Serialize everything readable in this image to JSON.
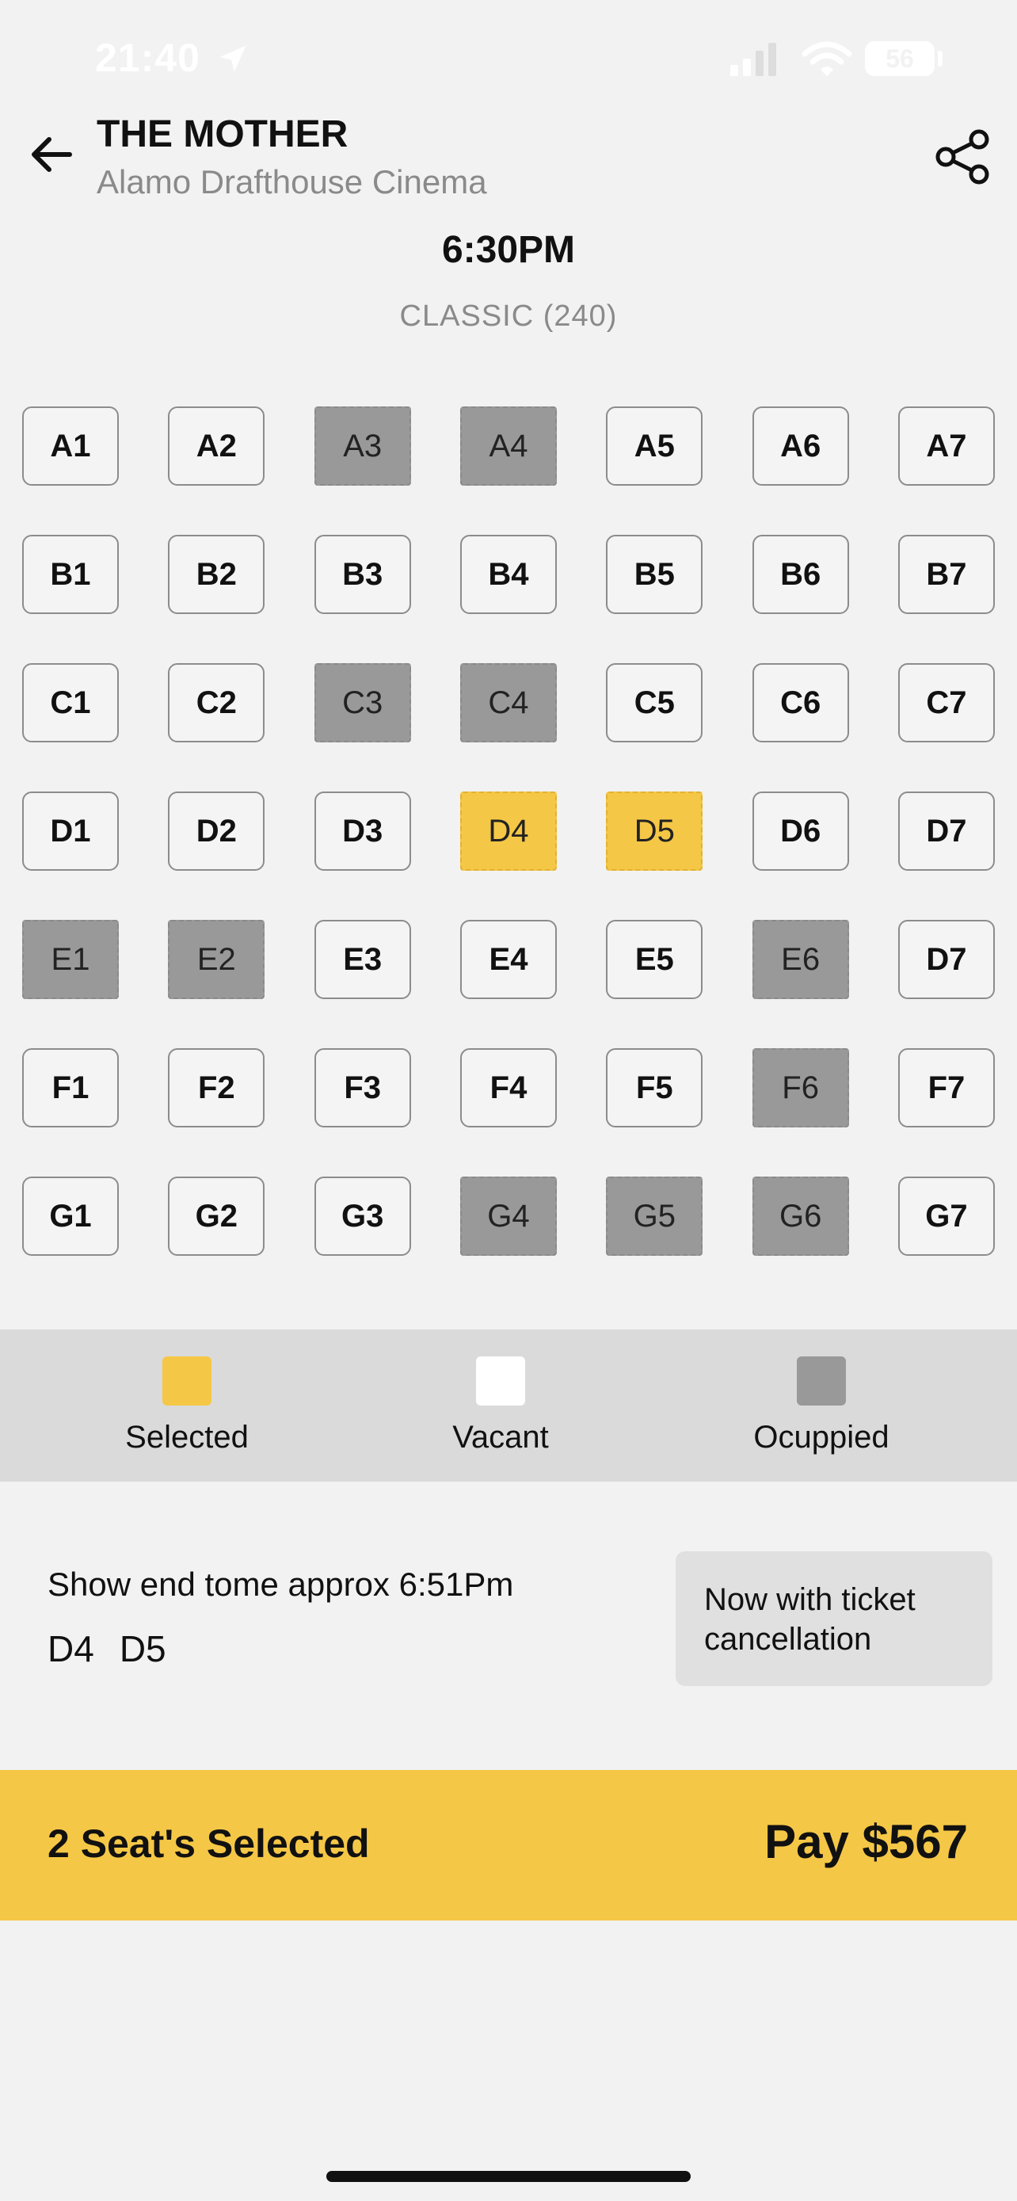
{
  "status_bar": {
    "time": "21:40",
    "battery": "56"
  },
  "header": {
    "movie_title": "THE MOTHER",
    "cinema_name": "Alamo Drafthouse Cinema",
    "showtime": "6:30PM",
    "screen_type": "CLASSIC (240)"
  },
  "seat_rows": [
    [
      {
        "label": "A1",
        "status": "vacant"
      },
      {
        "label": "A2",
        "status": "vacant"
      },
      {
        "label": "A3",
        "status": "occupied"
      },
      {
        "label": "A4",
        "status": "occupied"
      },
      {
        "label": "A5",
        "status": "vacant"
      },
      {
        "label": "A6",
        "status": "vacant"
      },
      {
        "label": "A7",
        "status": "vacant"
      }
    ],
    [
      {
        "label": "B1",
        "status": "vacant"
      },
      {
        "label": "B2",
        "status": "vacant"
      },
      {
        "label": "B3",
        "status": "vacant"
      },
      {
        "label": "B4",
        "status": "vacant"
      },
      {
        "label": "B5",
        "status": "vacant"
      },
      {
        "label": "B6",
        "status": "vacant"
      },
      {
        "label": "B7",
        "status": "vacant"
      }
    ],
    [
      {
        "label": "C1",
        "status": "vacant"
      },
      {
        "label": "C2",
        "status": "vacant"
      },
      {
        "label": "C3",
        "status": "occupied"
      },
      {
        "label": "C4",
        "status": "occupied"
      },
      {
        "label": "C5",
        "status": "vacant"
      },
      {
        "label": "C6",
        "status": "vacant"
      },
      {
        "label": "C7",
        "status": "vacant"
      }
    ],
    [
      {
        "label": "D1",
        "status": "vacant"
      },
      {
        "label": "D2",
        "status": "vacant"
      },
      {
        "label": "D3",
        "status": "vacant"
      },
      {
        "label": "D4",
        "status": "selected"
      },
      {
        "label": "D5",
        "status": "selected"
      },
      {
        "label": "D6",
        "status": "vacant"
      },
      {
        "label": "D7",
        "status": "vacant"
      }
    ],
    [
      {
        "label": "E1",
        "status": "occupied"
      },
      {
        "label": "E2",
        "status": "occupied"
      },
      {
        "label": "E3",
        "status": "vacant"
      },
      {
        "label": "E4",
        "status": "vacant"
      },
      {
        "label": "E5",
        "status": "vacant"
      },
      {
        "label": "E6",
        "status": "occupied"
      },
      {
        "label": "D7",
        "status": "vacant"
      }
    ],
    [
      {
        "label": "F1",
        "status": "vacant"
      },
      {
        "label": "F2",
        "status": "vacant"
      },
      {
        "label": "F3",
        "status": "vacant"
      },
      {
        "label": "F4",
        "status": "vacant"
      },
      {
        "label": "F5",
        "status": "vacant"
      },
      {
        "label": "F6",
        "status": "occupied"
      },
      {
        "label": "F7",
        "status": "vacant"
      }
    ],
    [
      {
        "label": "G1",
        "status": "vacant"
      },
      {
        "label": "G2",
        "status": "vacant"
      },
      {
        "label": "G3",
        "status": "vacant"
      },
      {
        "label": "G4",
        "status": "occupied"
      },
      {
        "label": "G5",
        "status": "occupied"
      },
      {
        "label": "G6",
        "status": "occupied"
      },
      {
        "label": "G7",
        "status": "vacant"
      }
    ]
  ],
  "legend": {
    "selected_label": "Selected",
    "vacant_label": "Vacant",
    "occupied_label": "Ocuppied"
  },
  "colors": {
    "selected": "#f5c746",
    "vacant": "#ffffff",
    "occupied": "#999999",
    "legend_bg": "#dadada"
  },
  "summary": {
    "end_time_text": "Show end tome approx 6:51Pm",
    "selected_seats": [
      "D4",
      "D5"
    ],
    "promo_text": "Now with ticket cancellation"
  },
  "pay_bar": {
    "seats_selected_text": "2 Seat's Selected",
    "pay_label": "Pay $567"
  }
}
